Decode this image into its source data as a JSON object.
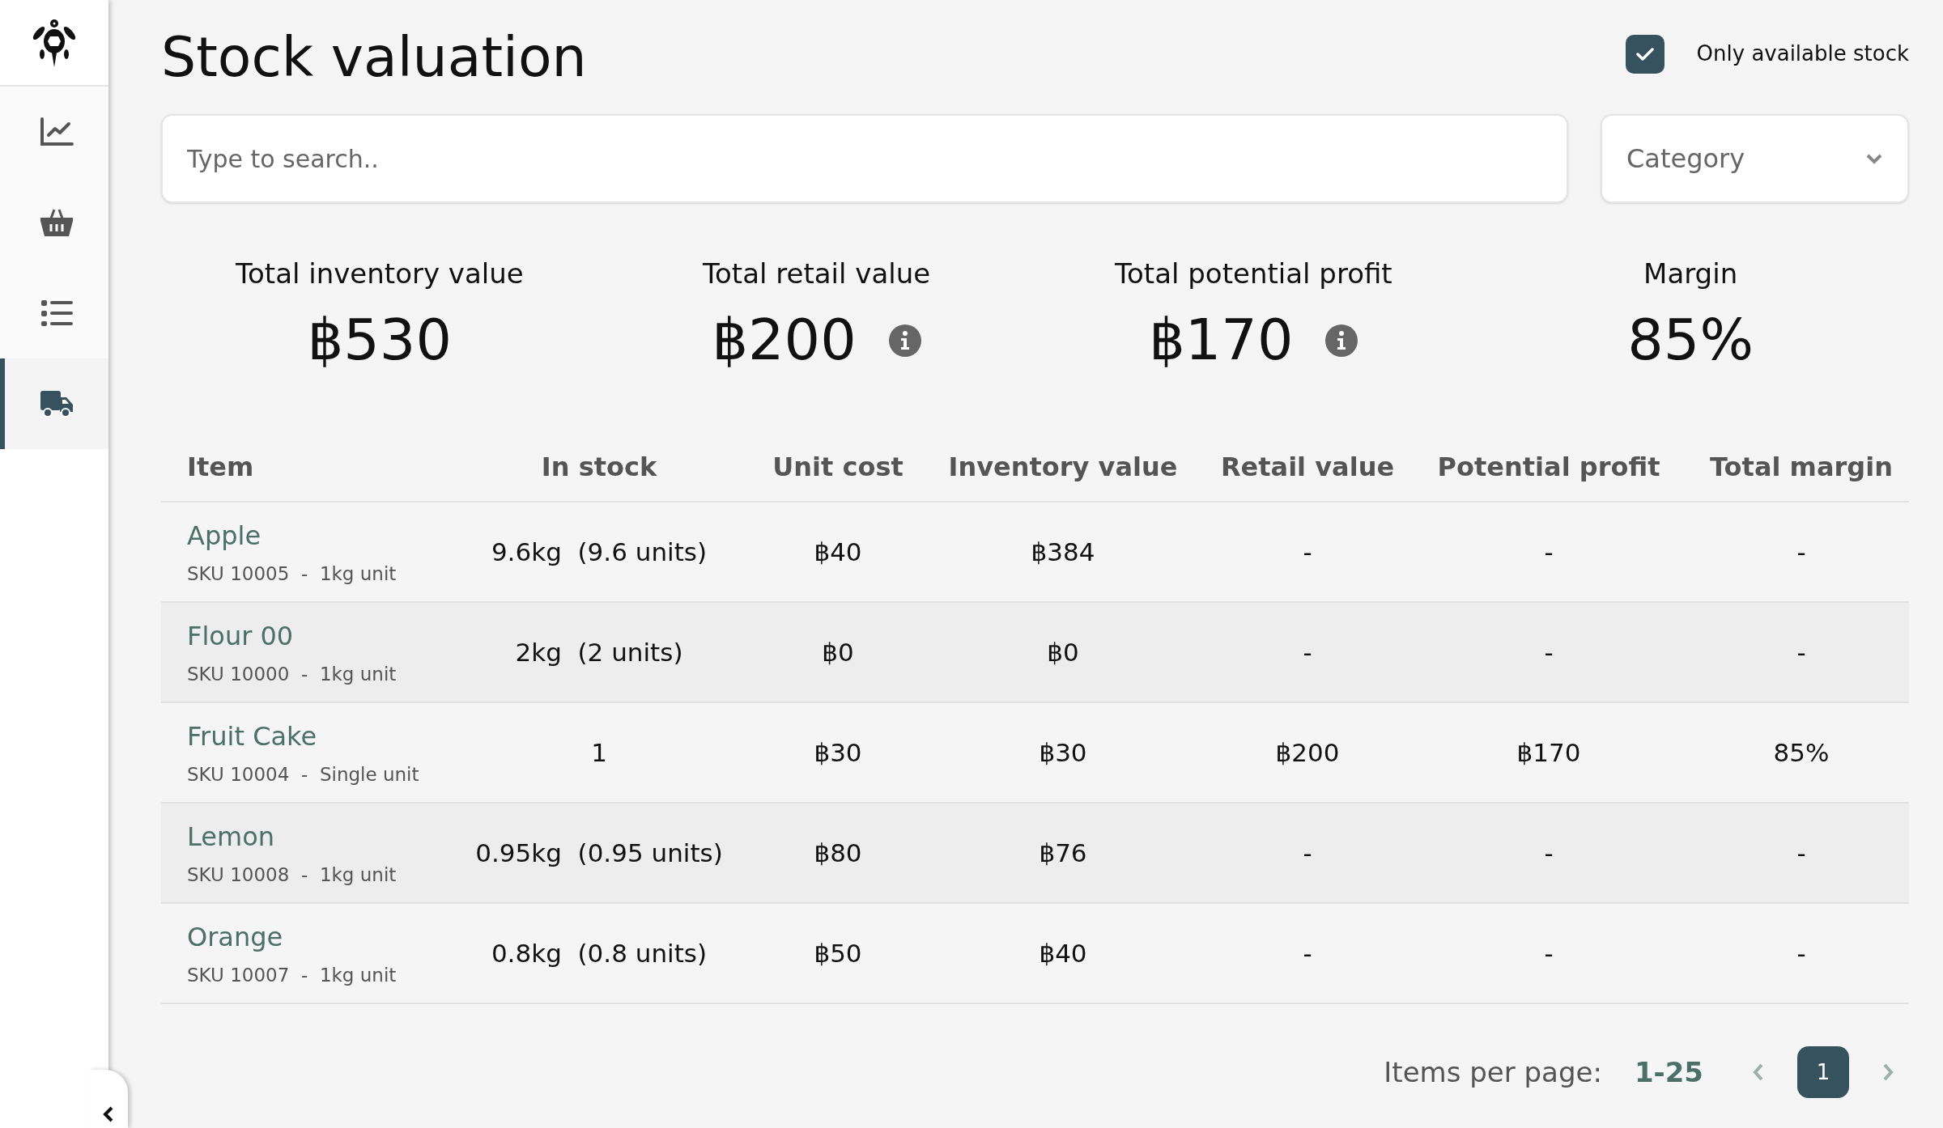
{
  "sidebar": {
    "items": [
      {
        "kind": "chart",
        "selected": false
      },
      {
        "kind": "basket",
        "selected": false
      },
      {
        "kind": "list",
        "selected": false
      },
      {
        "kind": "truck",
        "selected": true
      }
    ]
  },
  "title": "Stock valuation",
  "filter": {
    "label": "Only available stock",
    "checked": true
  },
  "search": {
    "placeholder": "Type to search.."
  },
  "category": {
    "placeholder": "Category"
  },
  "stats": [
    {
      "label": "Total inventory value",
      "value": "฿530",
      "info": false
    },
    {
      "label": "Total retail value",
      "value": "฿200",
      "info": true
    },
    {
      "label": "Total potential profit",
      "value": "฿170",
      "info": true
    },
    {
      "label": "Margin",
      "value": "85%",
      "info": false
    }
  ],
  "table": {
    "columns": [
      "Item",
      "In stock",
      "Unit cost",
      "Inventory value",
      "Retail value",
      "Potential profit",
      "Total margin"
    ],
    "rows": [
      {
        "cells": [
          {
            "name": "Apple",
            "detail": "SKU 10005  -  1kg unit"
          },
          "9.6kg  (9.6 units)",
          "฿40",
          "฿384",
          "-",
          "-",
          "-"
        ]
      },
      {
        "cells": [
          {
            "name": "Flour 00",
            "detail": "SKU 10000  -  1kg unit"
          },
          "2kg  (2 units)",
          "฿0",
          "฿0",
          "-",
          "-",
          "-"
        ]
      },
      {
        "cells": [
          {
            "name": "Fruit Cake",
            "detail": "SKU 10004  -  Single unit"
          },
          "1",
          "฿30",
          "฿30",
          "฿200",
          "฿170",
          "85%"
        ]
      },
      {
        "cells": [
          {
            "name": "Lemon",
            "detail": "SKU 10008  -  1kg unit"
          },
          "0.95kg  (0.95 units)",
          "฿80",
          "฿76",
          "-",
          "-",
          "-"
        ]
      },
      {
        "cells": [
          {
            "name": "Orange",
            "detail": "SKU 10007  -  1kg unit"
          },
          "0.8kg  (0.8 units)",
          "฿50",
          "฿40",
          "-",
          "-",
          "-"
        ]
      }
    ]
  },
  "pagination": {
    "label": "Items per page:",
    "per_page": "1-25",
    "pages": [
      {
        "label": "1",
        "selected": true
      }
    ]
  }
}
